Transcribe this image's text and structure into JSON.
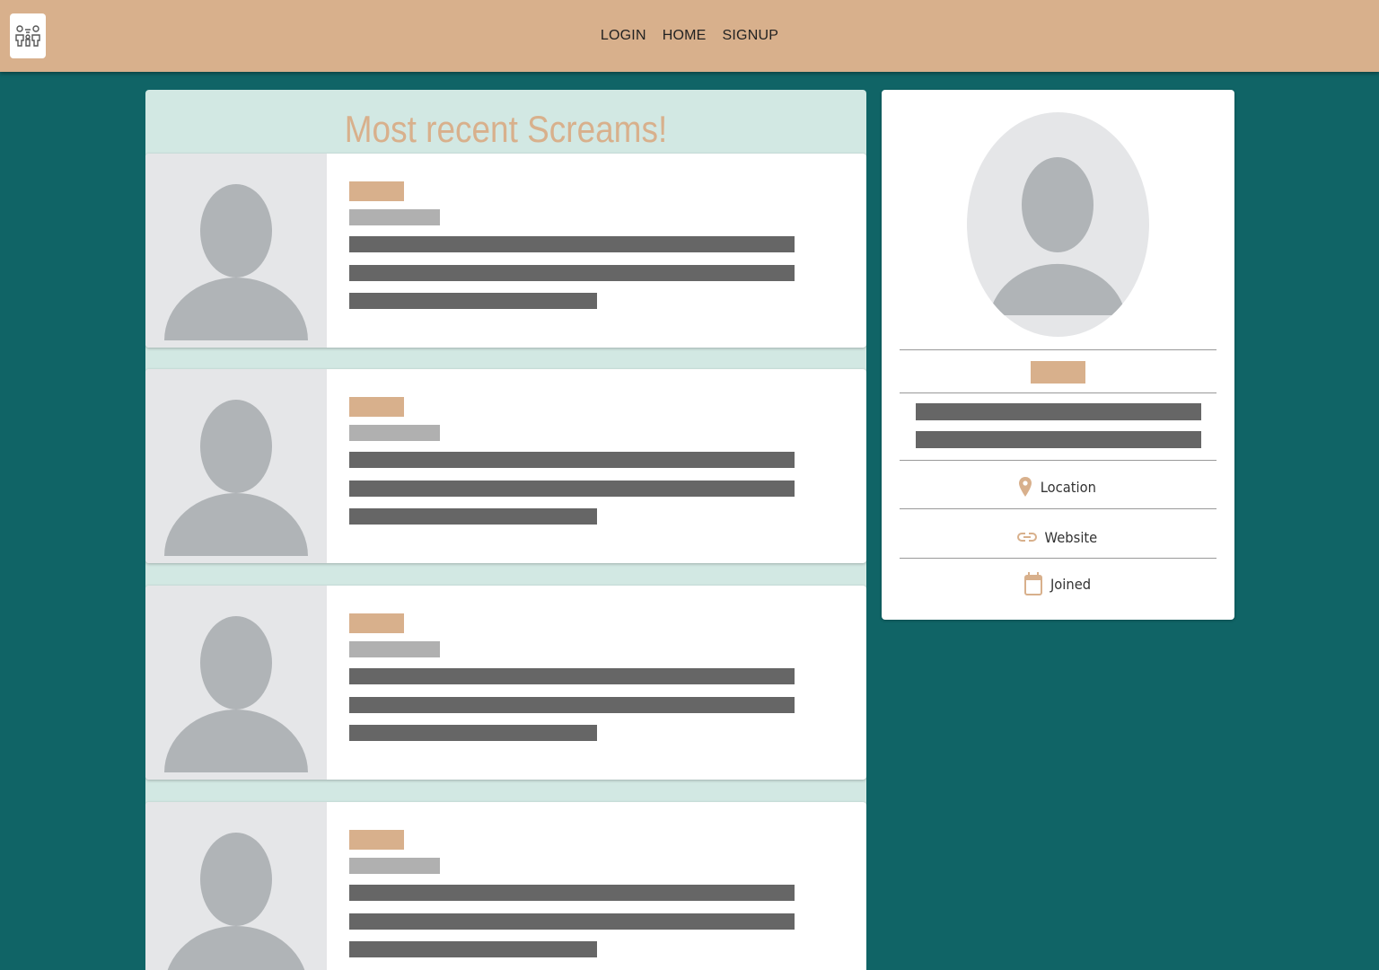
{
  "navbar": {
    "logo_icon": "family-logo-icon",
    "links": [
      "LOGIN",
      "HOME",
      "SIGNUP"
    ]
  },
  "feed": {
    "title": "Most recent Screams!",
    "cards": [
      {
        "avatar_icon": "user-placeholder-icon",
        "state": "loading-skeleton"
      },
      {
        "avatar_icon": "user-placeholder-icon",
        "state": "loading-skeleton"
      },
      {
        "avatar_icon": "user-placeholder-icon",
        "state": "loading-skeleton"
      },
      {
        "avatar_icon": "user-placeholder-icon",
        "state": "loading-skeleton"
      }
    ]
  },
  "profile": {
    "avatar_icon": "user-placeholder-icon",
    "location_label": "Location",
    "website_label": "Website",
    "joined_label": "Joined",
    "location_icon": "location-pin-icon",
    "website_icon": "link-icon",
    "joined_icon": "calendar-icon"
  },
  "colors": {
    "navbar": "#d8b08c",
    "page_background": "#106466",
    "feed_background": "#d2e8e3",
    "accent": "#d8b08c",
    "skeleton_text": "#666666",
    "skeleton_meta": "#b0b0b0",
    "avatar_background": "#e5e6e8",
    "avatar_figure": "#b0b4b7"
  }
}
